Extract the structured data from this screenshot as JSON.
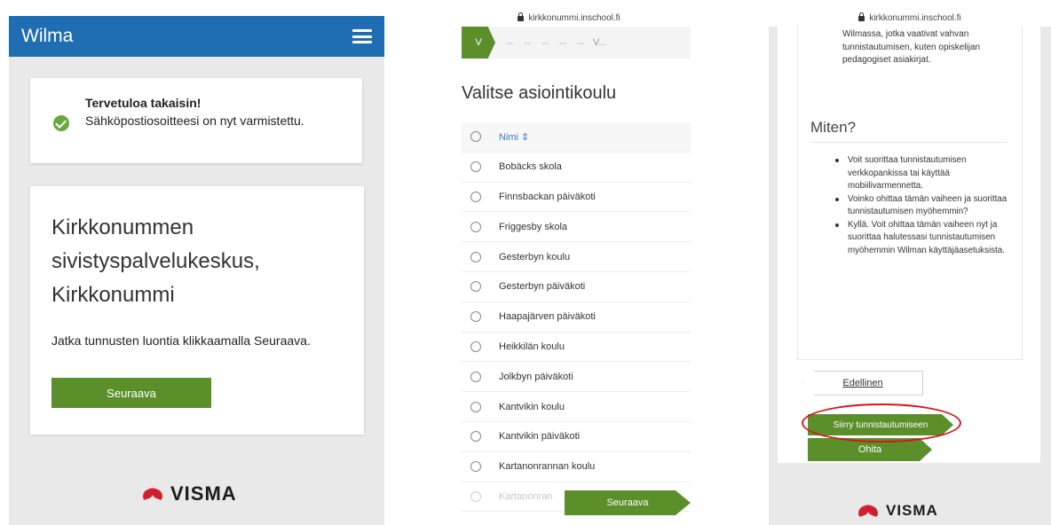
{
  "panel1": {
    "app_title": "Wilma",
    "notice": {
      "title": "Tervetuloa takaisin!",
      "text": "Sähköpostiosoitteesi on nyt varmistettu."
    },
    "org_name": "Kirkkonummen sivistyspalvelukeskus, Kirkkonummi",
    "instruction": "Jatka tunnusten luontia klikkaamalla Seuraava.",
    "next_label": "Seuraava",
    "brand": "VISMA"
  },
  "panel2": {
    "url": "kirkkonummi.inschool.fi",
    "stepper": {
      "active": "V",
      "steps": [
        "--",
        "--",
        "--",
        "--",
        "--"
      ],
      "last": "V..."
    },
    "title": "Valitse asiointikoulu",
    "column_header": "Nimi ⇕",
    "schools": [
      "Bobäcks skola",
      "Finnsbackan päiväkoti",
      "Friggesby skola",
      "Gesterbyn koulu",
      "Gesterbyn päiväkoti",
      "Haapajärven päiväkoti",
      "Heikkilän koulu",
      "Jolkbyn päiväkoti",
      "Kantvikin koulu",
      "Kantvikin päiväkoti",
      "Kartanonrannan koulu",
      "Kartanonran"
    ],
    "next_label": "Seuraava"
  },
  "panel3": {
    "url": "kirkkonummi.inschool.fi",
    "intro": "Wilmassa, jotka vaativat vahvan tunnistautumisen, kuten opiskelijan pedagogiset asiakirjat.",
    "heading": "Miten?",
    "bullets": [
      "Voit suorittaa tunnistautumisen verkkopankissa tai käyttää mobiilivarmennetta.",
      "Voinko ohittaa tämän vaiheen ja suorittaa tunnistautumisen myöhemmin?",
      "Kyllä. Voit ohittaa tämän vaiheen nyt ja suorittaa halutessasi tunnistautumisen myöhemmin Wilman käyttäjäasetuksista."
    ],
    "prev_label": "Edellinen",
    "auth_label": "Siirry tunnistautumiseen",
    "skip_label": "Ohita",
    "brand": "VISMA"
  },
  "colors": {
    "header_blue": "#1f6db3",
    "button_green": "#5a8f2a",
    "highlight_red": "#d9141c",
    "brand_red": "#d01f2e"
  }
}
